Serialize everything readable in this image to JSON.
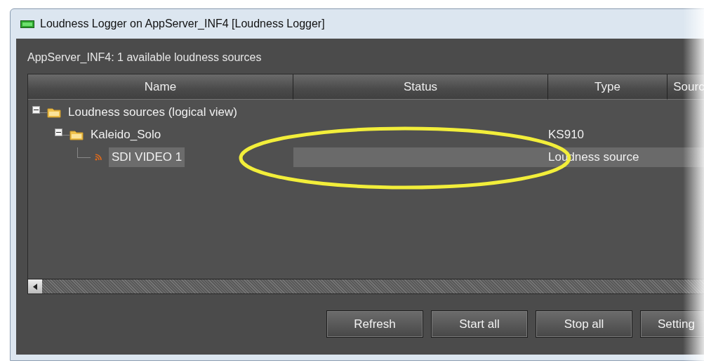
{
  "window": {
    "title": "Loudness Logger on AppServer_INF4 [Loudness Logger]"
  },
  "summary": "AppServer_INF4: 1 available loudness sources",
  "table": {
    "columns": [
      "Name",
      "Status",
      "Type",
      "Sourc"
    ],
    "rows": [
      {
        "kind": "folder",
        "name": "Loudness sources (logical view)",
        "expanded": true,
        "selected": false,
        "children": [
          {
            "kind": "folder",
            "name": "Kaleido_Solo",
            "type": "KS910",
            "expanded": true,
            "selected": false,
            "children": [
              {
                "kind": "source",
                "name": "SDI VIDEO 1",
                "type": "Loudness source",
                "selected": true
              }
            ]
          }
        ]
      }
    ]
  },
  "buttons": [
    "Refresh",
    "Start all",
    "Stop all",
    "Setting"
  ]
}
